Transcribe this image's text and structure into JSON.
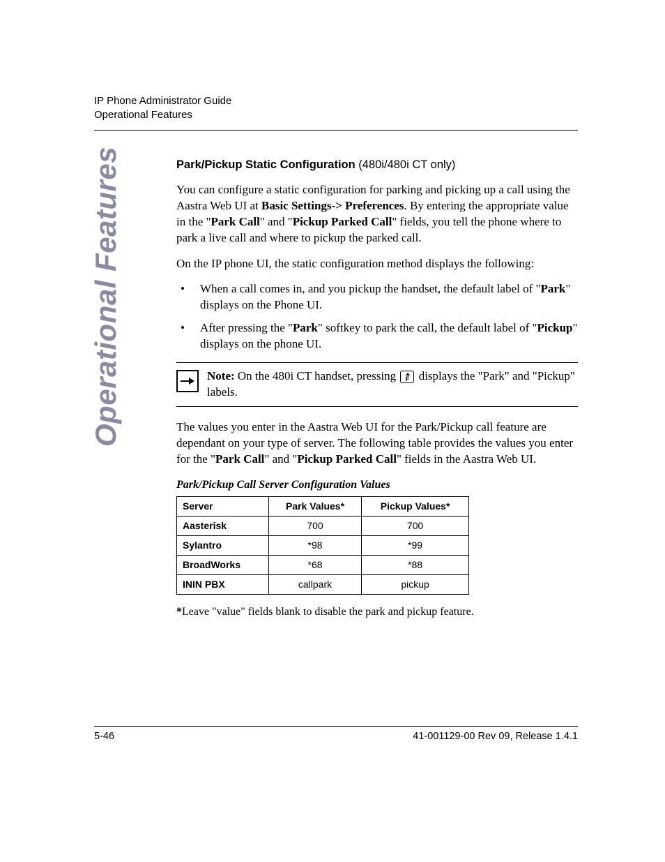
{
  "header": {
    "line1": "IP Phone Administrator Guide",
    "line2": "Operational Features"
  },
  "side_label": "Operational Features",
  "section": {
    "title_bold": "Park/Pickup Static Configuration",
    "title_suffix": " (480i/480i CT only)"
  },
  "para1": {
    "t1": "You can configure a static configuration for parking and picking up a call using the Aastra Web UI at ",
    "b1": "Basic Settings-> Preferences",
    "t2": ". By entering the appropriate value in the \"",
    "b2": "Park Call",
    "t3": "\" and \"",
    "b3": "Pickup Parked Call",
    "t4": "\" fields, you tell the phone where to park a live call and where to pickup the parked call."
  },
  "para2": "On the IP phone UI, the static configuration method displays the following:",
  "bullets": [
    {
      "t1": "When a call comes in, and you pickup the handset, the default label of \"",
      "b1": "Park",
      "t2": "\" displays on the Phone UI."
    },
    {
      "t1": "After pressing the \"",
      "b1": "Park",
      "t2": "\" softkey to park the call, the default label of \"",
      "b2": "Pickup",
      "t3": "\" displays on the phone UI."
    }
  ],
  "note": {
    "label": "Note:",
    "t1": " On the 480i CT handset, pressing ",
    "t2": " displays the \"Park\" and \"Pickup\" labels."
  },
  "para3": {
    "t1": "The values you enter in the Aastra Web UI for the Park/Pickup call feature are dependant on your type of server. The following table provides the values you enter for the \"",
    "b1": "Park Call",
    "t2": "\" and \"",
    "b2": "Pickup Parked Call",
    "t3": "\" fields in the Aastra Web UI."
  },
  "table": {
    "caption": "Park/Pickup Call Server Configuration Values",
    "headers": [
      "Server",
      "Park Values*",
      "Pickup Values*"
    ],
    "rows": [
      [
        "Aasterisk",
        "700",
        "700"
      ],
      [
        "Sylantro",
        "*98",
        "*99"
      ],
      [
        "BroadWorks",
        "*68",
        "*88"
      ],
      [
        "ININ PBX",
        "callpark",
        "pickup"
      ]
    ]
  },
  "footnote": {
    "b": "*",
    "t": "Leave \"value\" fields blank to disable the park and pickup feature."
  },
  "footer": {
    "left": "5-46",
    "right": "41-001129-00 Rev 09, Release 1.4.1"
  },
  "chart_data": {
    "type": "table",
    "title": "Park/Pickup Call Server Configuration Values",
    "columns": [
      "Server",
      "Park Values*",
      "Pickup Values*"
    ],
    "rows": [
      {
        "Server": "Aasterisk",
        "Park Values*": "700",
        "Pickup Values*": "700"
      },
      {
        "Server": "Sylantro",
        "Park Values*": "*98",
        "Pickup Values*": "*99"
      },
      {
        "Server": "BroadWorks",
        "Park Values*": "*68",
        "Pickup Values*": "*88"
      },
      {
        "Server": "ININ PBX",
        "Park Values*": "callpark",
        "Pickup Values*": "pickup"
      }
    ],
    "footnote": "*Leave \"value\" fields blank to disable the park and pickup feature."
  }
}
